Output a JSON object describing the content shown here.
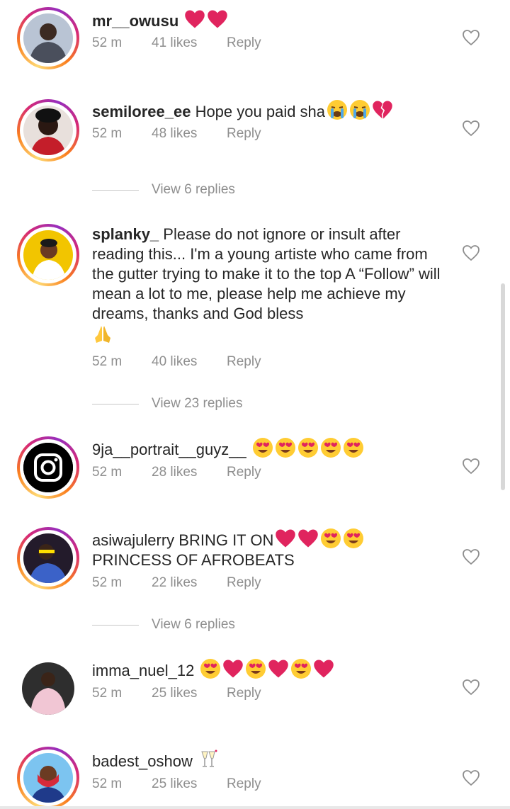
{
  "comments": [
    {
      "username": "mr__owusu",
      "text": "",
      "time": "52 m",
      "likes": "41 likes",
      "reply": "Reply"
    },
    {
      "username": "semiloree_ee",
      "text": "Hope you paid sha",
      "time": "52 m",
      "likes": "48 likes",
      "reply": "Reply",
      "view_replies": "View 6 replies"
    },
    {
      "username": "splanky_",
      "text": "Please do not ignore or insult after reading this... I'm a young artiste who came from the gutter trying to make it to the top A “Follow” will mean a lot to me, please help me achieve my dreams, thanks and God bless",
      "time": "52 m",
      "likes": "40 likes",
      "reply": "Reply",
      "view_replies": "View 23 replies"
    },
    {
      "username": "9ja__portrait__guyz__",
      "text": "",
      "time": "52 m",
      "likes": "28 likes",
      "reply": "Reply"
    },
    {
      "username": "asiwajulerry",
      "text": "BRING IT ON",
      "text2": "PRINCESS OF AFROBEATS",
      "time": "52 m",
      "likes": "22 likes",
      "reply": "Reply",
      "view_replies": "View 6 replies"
    },
    {
      "username": "imma_nuel_12",
      "text": "",
      "time": "52 m",
      "likes": "25 likes",
      "reply": "Reply"
    },
    {
      "username": "badest_oshow",
      "text": "",
      "time": "52 m",
      "likes": "25 likes",
      "reply": "Reply"
    }
  ],
  "colors": {
    "secondary": "#8e8e8e",
    "heart": "#e0245e",
    "ring_start": "#feda75",
    "ring_end": "#962fbf"
  }
}
